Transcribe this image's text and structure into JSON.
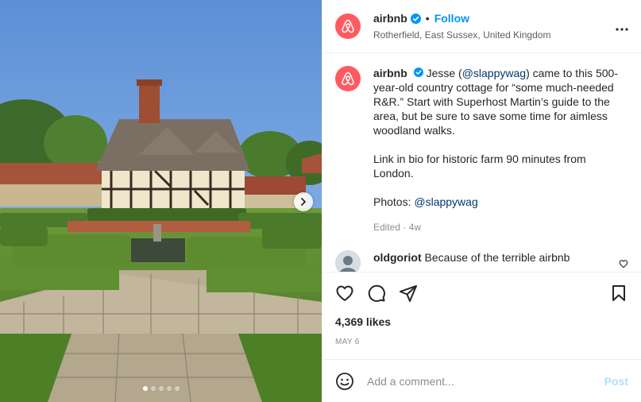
{
  "account": {
    "username": "airbnb",
    "follow_label": "Follow",
    "separator": "•",
    "location": "Rotherfield, East Sussex, United Kingdom",
    "brand_color": "#ff5a5f"
  },
  "caption": {
    "username": "airbnb",
    "p1_a": "Jesse (",
    "p1_mention": "@slappywag",
    "p1_b": ") came to this 500-year-old country cottage for “some much-needed R&R.” Start with Superhost Martin’s guide to the area, but be sure to save some time for aimless woodland walks.",
    "p2": "Link in bio for historic farm 90 minutes from London.",
    "p3_prefix": "Photos: ",
    "p3_mention": "@slappywag",
    "edited": "Edited · 4w"
  },
  "comment": {
    "username": "oldgoriot",
    "text": "Because of the terrible airbnb"
  },
  "stats": {
    "likes": "4,369 likes",
    "date": "MAY 6"
  },
  "comment_input": {
    "placeholder": "Add a comment...",
    "post_label": "Post"
  },
  "carousel": {
    "total_slides": 5,
    "active_slide": 1
  },
  "colors": {
    "accent": "#0095f6",
    "text": "#262626",
    "muted": "#8e8e8e",
    "link": "#00376b"
  },
  "icons": [
    "airbnb-logo-icon",
    "verified-badge-icon",
    "more-options-icon",
    "heart-icon",
    "comment-icon",
    "share-icon",
    "bookmark-icon",
    "emoji-icon",
    "chevron-right-icon"
  ]
}
